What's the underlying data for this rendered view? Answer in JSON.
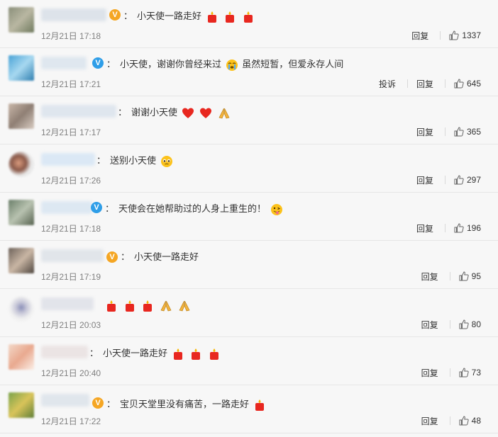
{
  "labels": {
    "reply": "回复",
    "report": "投诉",
    "colon": "："
  },
  "icons": {
    "verify_gold": "V",
    "verify_blue": "V"
  },
  "colors": {
    "gold_badge": "#f5a623",
    "blue_badge": "#2f9ee8",
    "candle": "#e8271f",
    "heart": "#e8271f"
  },
  "comments": [
    {
      "time": "12月21日 17:18",
      "text": "小天使一路走好",
      "likes": "1337",
      "emojis_after": [
        "candle-icon",
        "candle-icon",
        "candle-icon"
      ],
      "badge": "gold"
    },
    {
      "time": "12月21日 17:21",
      "text": "小天使，谢谢你曾经来过",
      "text_after": "虽然短暂，但爱永存人间",
      "likes": "645",
      "emojis_mid": [
        "crying-face-icon"
      ],
      "badge": "blue"
    },
    {
      "time": "12月21日 17:17",
      "text": "谢谢小天使",
      "likes": "365",
      "emojis_after": [
        "heart-icon",
        "heart-icon",
        "praying-hands-icon"
      ]
    },
    {
      "time": "12月21日 17:26",
      "text": "送别小天使",
      "likes": "297",
      "emojis_after": [
        "pleading-face-icon"
      ]
    },
    {
      "time": "12月21日 17:18",
      "text": "天使会在她帮助过的人身上重生的！",
      "likes": "196",
      "emojis_after": [
        "tongue-face-icon"
      ],
      "badge": "blue"
    },
    {
      "time": "12月21日 17:19",
      "text": "小天使一路走好",
      "likes": "95",
      "badge": "gold"
    },
    {
      "time": "12月21日 20:03",
      "text": "",
      "likes": "80",
      "emojis_after": [
        "candle-icon",
        "candle-icon",
        "candle-icon",
        "praying-hands-icon",
        "praying-hands-icon"
      ]
    },
    {
      "time": "12月21日 20:40",
      "text": "小天使一路走好",
      "likes": "73",
      "emojis_after": [
        "candle-icon",
        "candle-icon",
        "candle-icon"
      ]
    },
    {
      "time": "12月21日 17:22",
      "text": "宝贝天堂里没有痛苦，一路走好",
      "likes": "48",
      "emojis_after": [
        "candle-icon"
      ],
      "badge": "gold"
    }
  ]
}
